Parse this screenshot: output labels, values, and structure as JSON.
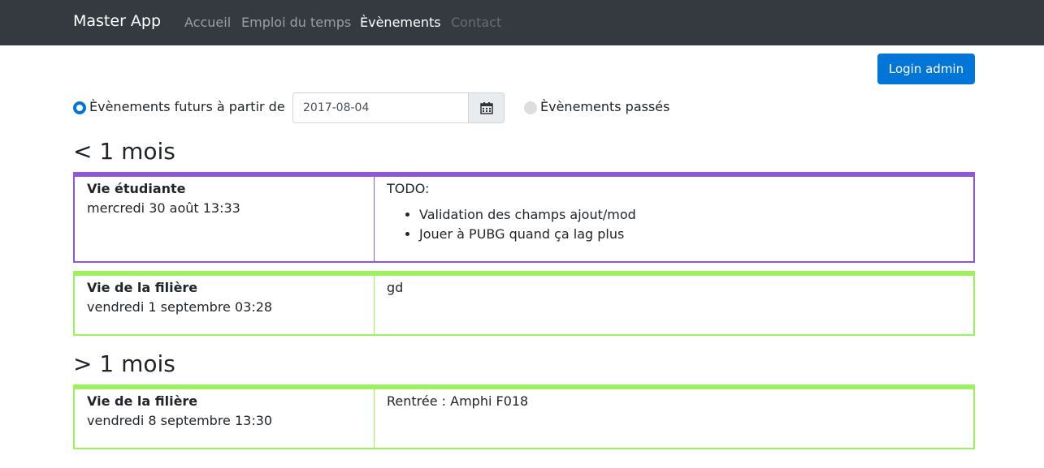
{
  "navbar": {
    "brand": "Master App",
    "links": [
      {
        "label": "Accueil"
      },
      {
        "label": "Emploi du temps"
      },
      {
        "label": "Èvènements"
      },
      {
        "label": "Contact"
      }
    ]
  },
  "login_label": "Login admin",
  "filter": {
    "future_label": "Èvènements futurs à partir de",
    "date_value": "2017-08-04",
    "past_label": "Èvènements passés",
    "calendar_icon": "calendar-icon"
  },
  "sections": [
    {
      "title": "< 1 mois"
    },
    {
      "title": "> 1 mois"
    }
  ],
  "events": [
    {
      "category": "Vie étudiante",
      "date": "mercredi 30 août 13:33",
      "description": "TODO:",
      "items": [
        "Validation des champs ajout/mod",
        "Jouer à PUBG quand ça lag plus"
      ],
      "color": "#8e57db"
    },
    {
      "category": "Vie de la filière",
      "date": "vendredi 1 septembre 03:28",
      "description": "gd",
      "color": "#9bf25a"
    },
    {
      "category": "Vie de la filière",
      "date": "vendredi 8 septembre 13:30",
      "description": "Rentrée : Amphi F018",
      "color": "#9bf25a"
    }
  ],
  "colors": {
    "navbar_bg": "#343a40",
    "primary": "#0275d8"
  }
}
